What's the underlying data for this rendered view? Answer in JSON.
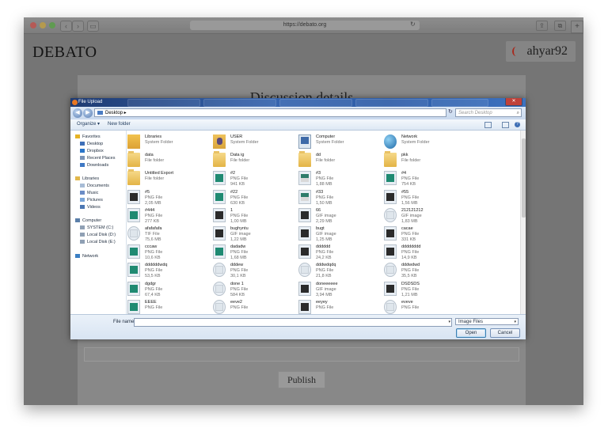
{
  "browser": {
    "url": "https://debato.org"
  },
  "site": {
    "logo": "DEBATO",
    "username": "ahyar92",
    "panel_title": "Discussion details",
    "publish_label": "Publish"
  },
  "dialog": {
    "title": "File Upload",
    "breadcrumb": "Desktop",
    "search_placeholder": "Search Desktop",
    "toolbar": {
      "organize": "Organize ▾",
      "new_folder": "New folder"
    },
    "nav": [
      {
        "label": "Favorites",
        "icon": "star-icon"
      },
      {
        "label": "Desktop",
        "icon": "desktop-icon"
      },
      {
        "label": "Dropbox",
        "icon": "dropbox-icon"
      },
      {
        "label": "Recent Places",
        "icon": "recent-places-icon"
      },
      {
        "label": "Downloads",
        "icon": "downloads-icon"
      },
      {
        "label": "Libraries",
        "icon": "libraries-icon"
      },
      {
        "label": "Documents",
        "icon": "documents-icon"
      },
      {
        "label": "Music",
        "icon": "music-icon"
      },
      {
        "label": "Pictures",
        "icon": "pictures-icon"
      },
      {
        "label": "Videos",
        "icon": "videos-icon"
      },
      {
        "label": "Computer",
        "icon": "computer-icon"
      },
      {
        "label": "SYSTEM (C:)",
        "icon": "drive-icon"
      },
      {
        "label": "Local Disk (D:)",
        "icon": "drive-icon"
      },
      {
        "label": "Local Disk (E:)",
        "icon": "drive-icon"
      },
      {
        "label": "Network",
        "icon": "network-icon"
      }
    ],
    "files": [
      {
        "name": "Libraries",
        "type": "System Folder",
        "size": "",
        "icon": "lib"
      },
      {
        "name": "USER",
        "type": "System Folder",
        "size": "",
        "icon": "user"
      },
      {
        "name": "Computer",
        "type": "System Folder",
        "size": "",
        "icon": "comp"
      },
      {
        "name": "Network",
        "type": "System Folder",
        "size": "",
        "icon": "net"
      },
      {
        "name": "data",
        "type": "File folder",
        "size": "",
        "icon": "folder"
      },
      {
        "name": "Data ig",
        "type": "File folder",
        "size": "",
        "icon": "folder"
      },
      {
        "name": "dd",
        "type": "File folder",
        "size": "",
        "icon": "folder"
      },
      {
        "name": "pkk",
        "type": "File folder",
        "size": "",
        "icon": "folder"
      },
      {
        "name": "Untitled Export",
        "type": "File folder",
        "size": "",
        "icon": "folder"
      },
      {
        "name": "#2",
        "type": "PNG File",
        "size": "941 KB",
        "icon": "green"
      },
      {
        "name": "#3",
        "type": "PNG File",
        "size": "1,88 MB",
        "icon": "mix"
      },
      {
        "name": "#4",
        "type": "PNG File",
        "size": "754 KB",
        "icon": "green"
      },
      {
        "name": "#5",
        "type": "PNG File",
        "size": "2,05 MB",
        "icon": "dark"
      },
      {
        "name": "#22",
        "type": "PNG File",
        "size": "630 KB",
        "icon": "green"
      },
      {
        "name": "#33",
        "type": "PNG File",
        "size": "1,50 MB",
        "icon": "mix"
      },
      {
        "name": "#55",
        "type": "PNG File",
        "size": "1,56 MB",
        "icon": "dark"
      },
      {
        "name": "#444",
        "type": "PNG File",
        "size": "277 KB",
        "icon": "green"
      },
      {
        "name": "1",
        "type": "PNG File",
        "size": "1,00 MB",
        "icon": "dark"
      },
      {
        "name": "66",
        "type": "GIF image",
        "size": "2,29 MB",
        "icon": "dark"
      },
      {
        "name": "212121212",
        "type": "GIF image",
        "size": "1,83 MB",
        "icon": "light"
      },
      {
        "name": "afafafafa",
        "type": "TIF File",
        "size": "75,6 MB",
        "icon": "light"
      },
      {
        "name": "bughyntu",
        "type": "GIF image",
        "size": "1,22 MB",
        "icon": "dark"
      },
      {
        "name": "bugt",
        "type": "GIF image",
        "size": "1,25 MB",
        "icon": "dark"
      },
      {
        "name": "cacae",
        "type": "PNG File",
        "size": "331 KB",
        "icon": "dark"
      },
      {
        "name": "cccaw",
        "type": "PNG File",
        "size": "10,6 KB",
        "icon": "green"
      },
      {
        "name": "dadadw",
        "type": "PNG File",
        "size": "1,68 MB",
        "icon": "green"
      },
      {
        "name": "dddddd",
        "type": "PNG File",
        "size": "24,2 KB",
        "icon": "dark"
      },
      {
        "name": "dddddddd",
        "type": "PNG File",
        "size": "14,9 KB",
        "icon": "dark"
      },
      {
        "name": "ddddddwdq",
        "type": "PNG File",
        "size": "53,5 KB",
        "icon": "green"
      },
      {
        "name": "dddew",
        "type": "PNG File",
        "size": "30,1 KB",
        "icon": "light"
      },
      {
        "name": "dddwdqdq",
        "type": "PNG File",
        "size": "21,8 KB",
        "icon": "light"
      },
      {
        "name": "dddwdwd",
        "type": "PNG File",
        "size": "35,5 KB",
        "icon": "light"
      },
      {
        "name": "dgdgr",
        "type": "PNG File",
        "size": "67,4 KB",
        "icon": "green"
      },
      {
        "name": "done 1",
        "type": "PNG File",
        "size": "584 KB",
        "icon": "light"
      },
      {
        "name": "doneeeeee",
        "type": "GIF image",
        "size": "3,94 MB",
        "icon": "dark"
      },
      {
        "name": "DSDSDS",
        "type": "PNG File",
        "size": "1,21 MB",
        "icon": "dark"
      },
      {
        "name": "EEEE",
        "type": "PNG File",
        "size": "",
        "icon": "green"
      },
      {
        "name": "eeve2",
        "type": "PNG File",
        "size": "",
        "icon": "light"
      },
      {
        "name": "eeyey",
        "type": "PNG File",
        "size": "",
        "icon": "dark"
      },
      {
        "name": "eveve",
        "type": "PNG File",
        "size": "",
        "icon": "light"
      }
    ],
    "footer": {
      "filename_label": "File name:",
      "filename_value": "",
      "filter_value": "Image Files",
      "open_label": "Open",
      "cancel_label": "Cancel"
    }
  }
}
